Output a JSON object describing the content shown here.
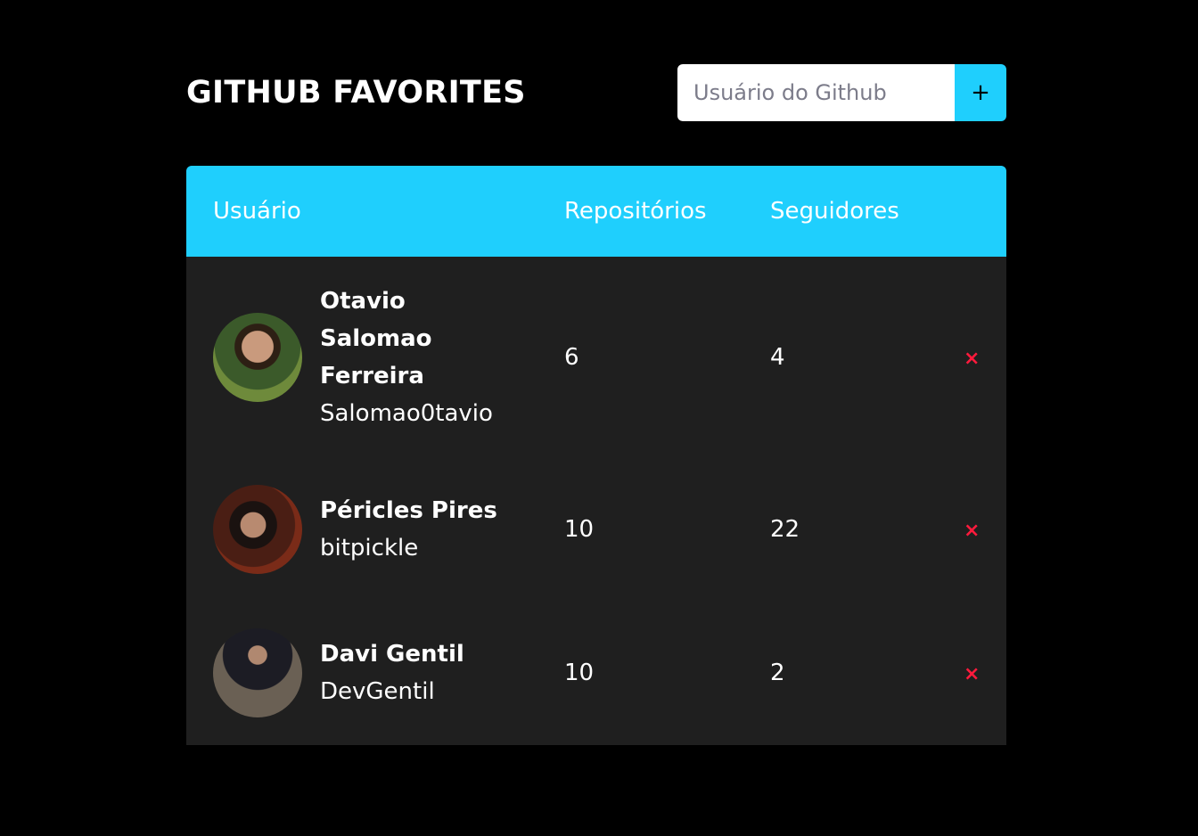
{
  "header": {
    "title": "GITHUB FAVORITES",
    "search_placeholder": "Usuário do Github",
    "add_label": "+"
  },
  "table": {
    "columns": [
      "Usuário",
      "Repositórios",
      "Seguidores"
    ],
    "rows": [
      {
        "name": "Otavio Salomao Ferreira",
        "login": "Salomao0tavio",
        "repositories": "6",
        "followers": "4",
        "remove_label": "×"
      },
      {
        "name": "Péricles Pires",
        "login": "bitpickle",
        "repositories": "10",
        "followers": "22",
        "remove_label": "×"
      },
      {
        "name": "Davi Gentil",
        "login": "DevGentil",
        "repositories": "10",
        "followers": "2",
        "remove_label": "×"
      }
    ]
  },
  "colors": {
    "accent": "#1fcffd",
    "background": "#000000",
    "row_background": "#1f1f1f",
    "remove": "#ff1a3c"
  }
}
